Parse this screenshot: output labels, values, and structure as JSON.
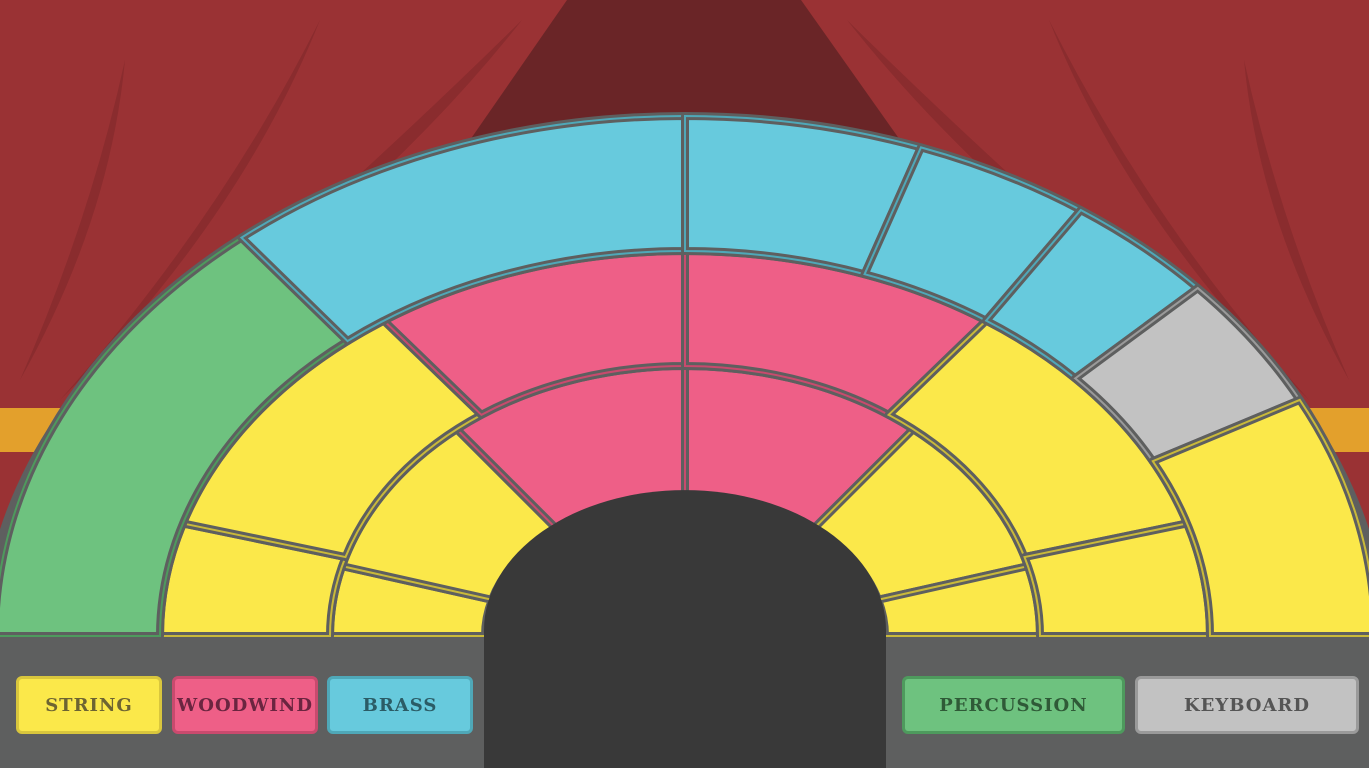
{
  "colors": {
    "string": "#fbe84a",
    "woodwind": "#ee5f87",
    "brass": "#67cadd",
    "percussion": "#6ec27f",
    "keyboard": "#c2c2c2",
    "stage": "#5e5f5f",
    "podium": "#393939",
    "curtain": "#9a3234",
    "curtain_back": "#6a2527",
    "tieback": "#e3a02c"
  },
  "sections": [
    {
      "key": "string",
      "label": "STRING"
    },
    {
      "key": "woodwind",
      "label": "WOODWIND"
    },
    {
      "key": "brass",
      "label": "BRASS"
    },
    {
      "key": "percussion",
      "label": "PERCUSSION"
    },
    {
      "key": "keyboard",
      "label": "KEYBOARD"
    }
  ],
  "seats": [
    {
      "name": "seat-string-r1-left-low",
      "section": "string"
    },
    {
      "name": "seat-string-r1-left-high",
      "section": "string"
    },
    {
      "name": "seat-woodwind-r1-left",
      "section": "woodwind"
    },
    {
      "name": "seat-woodwind-r1-right",
      "section": "woodwind"
    },
    {
      "name": "seat-string-r1-right-high",
      "section": "string"
    },
    {
      "name": "seat-string-r1-right-low",
      "section": "string"
    },
    {
      "name": "seat-string-r2-left-low",
      "section": "string"
    },
    {
      "name": "seat-string-r2-left-high",
      "section": "string"
    },
    {
      "name": "seat-woodwind-r2-left",
      "section": "woodwind"
    },
    {
      "name": "seat-woodwind-r2-right",
      "section": "woodwind"
    },
    {
      "name": "seat-string-r2-right-high",
      "section": "string"
    },
    {
      "name": "seat-string-r2-right-low",
      "section": "string"
    },
    {
      "name": "seat-percussion",
      "section": "percussion"
    },
    {
      "name": "seat-brass-left",
      "section": "brass"
    },
    {
      "name": "seat-brass-right-1",
      "section": "brass"
    },
    {
      "name": "seat-brass-right-2",
      "section": "brass"
    },
    {
      "name": "seat-brass-right-3",
      "section": "brass"
    },
    {
      "name": "seat-keyboard",
      "section": "keyboard"
    },
    {
      "name": "seat-string-r3-right",
      "section": "string"
    }
  ]
}
